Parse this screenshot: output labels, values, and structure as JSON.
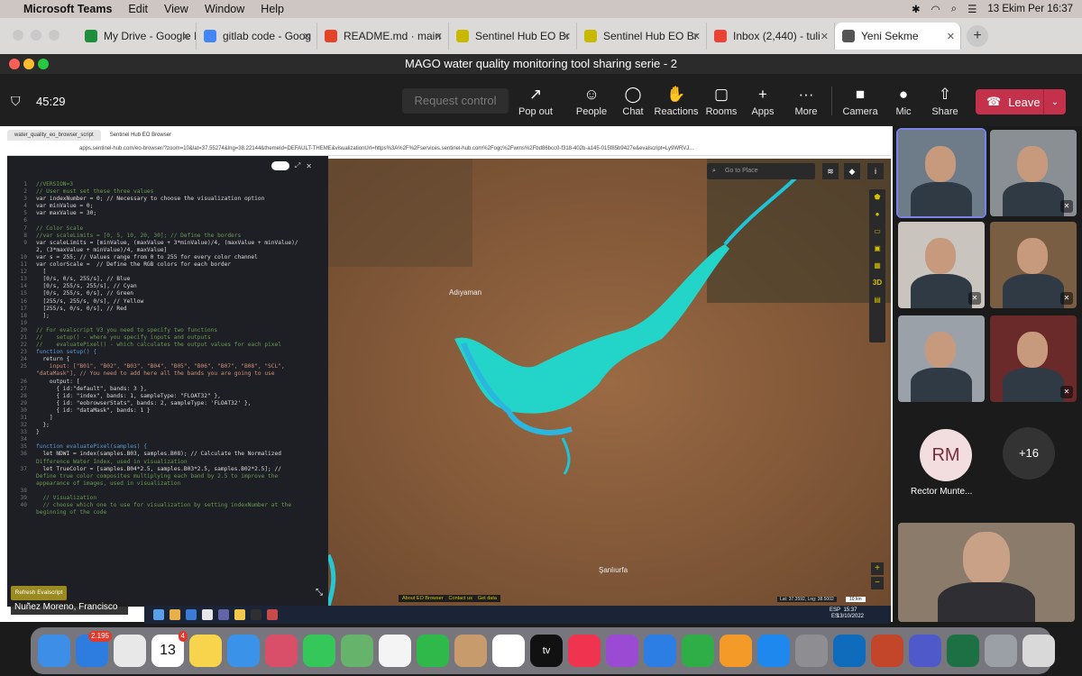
{
  "menubar": {
    "app": "Microsoft Teams",
    "items": [
      "Edit",
      "View",
      "Window",
      "Help"
    ],
    "clock": "13 Ekim Per  16:37"
  },
  "browser_tabs": [
    {
      "label": "My Drive - Google I",
      "color": "#1e8e3e"
    },
    {
      "label": "gitlab code - Goog",
      "color": "#4285f4"
    },
    {
      "label": "README.md · main",
      "color": "#e24329"
    },
    {
      "label": "Sentinel Hub EO Br",
      "color": "#c8b900"
    },
    {
      "label": "Sentinel Hub EO Br",
      "color": "#c8b900"
    },
    {
      "label": "Inbox (2,440) - tuli",
      "color": "#ea4335"
    },
    {
      "label": "Yeni Sekme",
      "color": "#555555"
    }
  ],
  "meeting": {
    "title": "MAGO water quality monitoring tool sharing serie - 2",
    "timer": "45:29",
    "request_control": "Request control",
    "buttons": [
      {
        "label": "Pop out",
        "icon": "↗"
      },
      {
        "label": "People",
        "icon": "☺"
      },
      {
        "label": "Chat",
        "icon": "◯"
      },
      {
        "label": "Reactions",
        "icon": "✋"
      },
      {
        "label": "Rooms",
        "icon": "▢"
      },
      {
        "label": "Apps",
        "icon": "+"
      },
      {
        "label": "More",
        "icon": "···"
      },
      {
        "label": "Camera",
        "icon": "■"
      },
      {
        "label": "Mic",
        "icon": "●"
      },
      {
        "label": "Share",
        "icon": "⇧"
      }
    ],
    "leave": "Leave"
  },
  "shared_screen": {
    "tabs": [
      "water_quality_eo_browser_script",
      "Sentinel Hub EO Browser"
    ],
    "url": "apps.sentinel-hub.com/eo-browser/?zoom=10&lat=37.55274&lng=38.22144&themeId=DEFAULT-THEME&visualizationUrl=https%3A%2F%2Fservices.sentinel-hub.com%2Fogc%2Fwms%2Fbd86bcc0-f318-402b-a145-015f85b9427e&evalscript=Ly9WRVJ...",
    "search_placeholder": "Go to Place",
    "map_labels": [
      "Adıyaman",
      "Şanlıurfa"
    ],
    "map_footer": [
      "About EO Browser",
      "Contact us",
      "Get data"
    ],
    "map_coords": "Lat: 37.3592, Lng: 38.5002",
    "scale": "10 km",
    "refresh_button": "Refresh Evalscript",
    "win_clock": [
      "15:37",
      "13/10/2022"
    ],
    "win_lang": [
      "ESP",
      "ES"
    ],
    "presenter_name": "Nuñez Moreno, Francisco"
  },
  "code_lines": [
    {
      "n": "1",
      "t": "//VERSION=3",
      "c": "cm"
    },
    {
      "n": "2",
      "t": "// User must set these three values",
      "c": "cm"
    },
    {
      "n": "3",
      "t": "var indexNumber = 0; // Necessary to choose the visualization option",
      "c": ""
    },
    {
      "n": "4",
      "t": "var minValue = 0;",
      "c": ""
    },
    {
      "n": "5",
      "t": "var maxValue = 30;",
      "c": ""
    },
    {
      "n": "6",
      "t": "",
      "c": ""
    },
    {
      "n": "7",
      "t": "// Color Scale",
      "c": "cm"
    },
    {
      "n": "8",
      "t": "//var scaleLimits = [0, 5, 10, 20, 30]; // Define the borders",
      "c": "cm"
    },
    {
      "n": "9",
      "t": "var scaleLimits = [minValue, (maxValue + 3*minValue)/4, (maxValue + minValue)/",
      "c": ""
    },
    {
      "n": "",
      "t": "2, (3*maxValue + minValue)/4, maxValue]",
      "c": ""
    },
    {
      "n": "10",
      "t": "var s = 255; // Values range from 0 to 255 for every color channel",
      "c": ""
    },
    {
      "n": "11",
      "t": "var colorScale =  // Define the RGB colors for each border",
      "c": ""
    },
    {
      "n": "12",
      "t": "  [",
      "c": ""
    },
    {
      "n": "13",
      "t": "  [0/s, 0/s, 255/s], // Blue",
      "c": ""
    },
    {
      "n": "14",
      "t": "  [0/s, 255/s, 255/s], // Cyan",
      "c": ""
    },
    {
      "n": "15",
      "t": "  [0/s, 255/s, 0/s], // Green",
      "c": ""
    },
    {
      "n": "16",
      "t": "  [255/s, 255/s, 0/s], // Yellow",
      "c": ""
    },
    {
      "n": "17",
      "t": "  [255/s, 0/s, 0/s], // Red",
      "c": ""
    },
    {
      "n": "18",
      "t": "  ];",
      "c": ""
    },
    {
      "n": "19",
      "t": "",
      "c": ""
    },
    {
      "n": "20",
      "t": "// For evalscript V3 you need to specify two functions",
      "c": "cm"
    },
    {
      "n": "21",
      "t": "//    setup() - where you specify inputs and outputs",
      "c": "cm"
    },
    {
      "n": "22",
      "t": "//    evaluatePixel() - which calculates the output values for each pixel",
      "c": "cm"
    },
    {
      "n": "23",
      "t": "function setup() {",
      "c": "kw"
    },
    {
      "n": "24",
      "t": "  return {",
      "c": ""
    },
    {
      "n": "25",
      "t": "    input: [\"B01\", \"B02\", \"B03\", \"B04\", \"B05\", \"B06\", \"B07\", \"B08\", \"SCL\",",
      "c": "st"
    },
    {
      "n": "",
      "t": "\"dataMask\"], // You need to add here all the bands you are going to use",
      "c": "st"
    },
    {
      "n": "26",
      "t": "    output: [",
      "c": ""
    },
    {
      "n": "27",
      "t": "      { id:\"default\", bands: 3 },",
      "c": ""
    },
    {
      "n": "28",
      "t": "      { id: \"index\", bands: 1, sampleType: \"FLOAT32\" },",
      "c": ""
    },
    {
      "n": "29",
      "t": "      { id: \"eobrowserStats\", bands: 2, sampleType: 'FLOAT32' },",
      "c": ""
    },
    {
      "n": "30",
      "t": "      { id: \"dataMask\", bands: 1 }",
      "c": ""
    },
    {
      "n": "31",
      "t": "    ]",
      "c": ""
    },
    {
      "n": "32",
      "t": "  };",
      "c": ""
    },
    {
      "n": "33",
      "t": "}",
      "c": ""
    },
    {
      "n": "34",
      "t": "",
      "c": ""
    },
    {
      "n": "35",
      "t": "function evaluatePixel(samples) {",
      "c": "kw"
    },
    {
      "n": "36",
      "t": "  let NDWI = index(samples.B03, samples.B08); // Calculate the Normalized",
      "c": ""
    },
    {
      "n": "",
      "t": "Difference Water Index, used in visualization",
      "c": "cm"
    },
    {
      "n": "37",
      "t": "  let TrueColor = [samples.B04*2.5, samples.B03*2.5, samples.B02*2.5]; //",
      "c": ""
    },
    {
      "n": "",
      "t": "Define true color composites multiplying each band by 2.5 to improve the",
      "c": "cm"
    },
    {
      "n": "",
      "t": "appearance of images, used in visualization",
      "c": "cm"
    },
    {
      "n": "38",
      "t": "",
      "c": ""
    },
    {
      "n": "39",
      "t": "  // Visualization",
      "c": "cm"
    },
    {
      "n": "40",
      "t": "  // choose which one to use for visualization by setting indexNumber at the",
      "c": "cm"
    },
    {
      "n": "",
      "t": "beginning of the code",
      "c": "cm"
    }
  ],
  "participants": [
    {
      "kind": "video",
      "muted": false,
      "active": true,
      "bg": "#6d7c88"
    },
    {
      "kind": "video",
      "muted": true,
      "active": false,
      "bg": "#8a8f94"
    },
    {
      "kind": "video",
      "muted": true,
      "active": false,
      "bg": "#c9c4bd"
    },
    {
      "kind": "video",
      "muted": true,
      "active": false,
      "bg": "#7a5e44"
    },
    {
      "kind": "video",
      "muted": false,
      "active": false,
      "bg": "#9aa1a8"
    },
    {
      "kind": "video",
      "muted": true,
      "active": false,
      "bg": "#6b2a2a"
    }
  ],
  "avatar": {
    "initials": "RM",
    "name": "Rector Munte...",
    "color": "#f2dede"
  },
  "more_count": "+16",
  "dock": [
    {
      "name": "finder",
      "color": "#3d8ee6",
      "label": "",
      "badge": ""
    },
    {
      "name": "mail",
      "color": "#2d7de0",
      "label": "",
      "badge": "2.195"
    },
    {
      "name": "chrome",
      "color": "#e8e8e8",
      "label": "",
      "badge": ""
    },
    {
      "name": "calendar",
      "color": "#ffffff",
      "label": "13",
      "badge": "4"
    },
    {
      "name": "notes",
      "color": "#f7d44c",
      "label": "",
      "badge": ""
    },
    {
      "name": "safari",
      "color": "#3a93e8",
      "label": "",
      "badge": ""
    },
    {
      "name": "launchpad",
      "color": "#d94f6a",
      "label": "",
      "badge": ""
    },
    {
      "name": "messages",
      "color": "#35c759",
      "label": "",
      "badge": ""
    },
    {
      "name": "maps",
      "color": "#66b36b",
      "label": "",
      "badge": ""
    },
    {
      "name": "photos",
      "color": "#f4f4f4",
      "label": "",
      "badge": ""
    },
    {
      "name": "facetime",
      "color": "#2fb94a",
      "label": "",
      "badge": ""
    },
    {
      "name": "contacts",
      "color": "#c79b6c",
      "label": "",
      "badge": ""
    },
    {
      "name": "reminders",
      "color": "#ffffff",
      "label": "",
      "badge": ""
    },
    {
      "name": "tv",
      "color": "#111111",
      "label": "tv",
      "badge": ""
    },
    {
      "name": "music",
      "color": "#f0344f",
      "label": "",
      "badge": ""
    },
    {
      "name": "podcasts",
      "color": "#9b4ad4",
      "label": "",
      "badge": ""
    },
    {
      "name": "keynote",
      "color": "#2c7ee4",
      "label": "",
      "badge": ""
    },
    {
      "name": "numbers",
      "color": "#2fae47",
      "label": "",
      "badge": ""
    },
    {
      "name": "pages",
      "color": "#f49a29",
      "label": "",
      "badge": ""
    },
    {
      "name": "app-store",
      "color": "#1e88ee",
      "label": "",
      "badge": ""
    },
    {
      "name": "settings",
      "color": "#8d8d92",
      "label": "",
      "badge": ""
    },
    {
      "name": "outlook",
      "color": "#0f6cbd",
      "label": "",
      "badge": ""
    },
    {
      "name": "powerpoint",
      "color": "#c4462a",
      "label": "",
      "badge": ""
    },
    {
      "name": "teams",
      "color": "#5059c9",
      "label": "",
      "badge": ""
    },
    {
      "name": "excel",
      "color": "#1d7044",
      "label": "",
      "badge": ""
    },
    {
      "name": "downloads",
      "color": "#9aa0a6",
      "label": "",
      "badge": ""
    },
    {
      "name": "trash",
      "color": "#d9d9d9",
      "label": "",
      "badge": ""
    }
  ]
}
